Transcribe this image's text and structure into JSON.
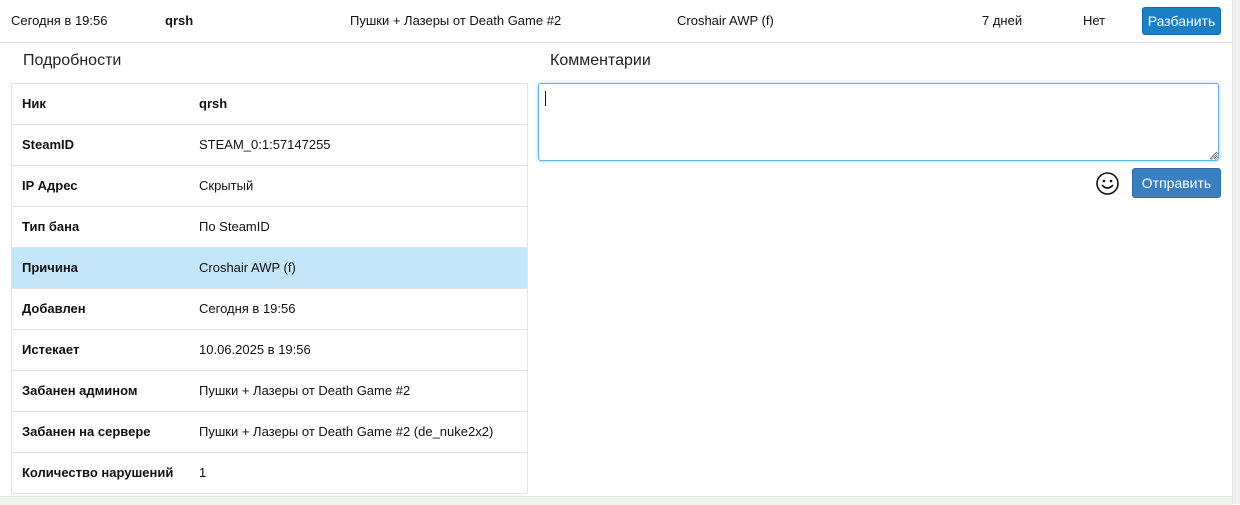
{
  "ban_row": {
    "date": "Сегодня в 19:56",
    "nick": "qrsh",
    "admin": "Пушки + Лазеры от Death Game #2",
    "reason": "Croshair AWP (f)",
    "duration": "7 дней",
    "status": "Нет",
    "unban_label": "Разбанить",
    "accent": "#1a7fc4"
  },
  "details": {
    "title": "Подробности",
    "rows": [
      {
        "label": "Ник",
        "value": "qrsh"
      },
      {
        "label": "SteamID",
        "value": "STEAM_0:1:57147255"
      },
      {
        "label": "IP Адрес",
        "value": "Скрытый"
      },
      {
        "label": "Тип бана",
        "value": "По SteamID"
      },
      {
        "label": "Причина",
        "value": "Croshair AWP (f)"
      },
      {
        "label": "Добавлен",
        "value": "Сегодня в 19:56"
      },
      {
        "label": "Истекает",
        "value": "10.06.2025 в 19:56"
      },
      {
        "label": "Забанен админом",
        "value": "Пушки + Лазеры от Death Game #2"
      },
      {
        "label": "Забанен на сервере",
        "value": "Пушки + Лазеры от Death Game #2 (de_nuke2x2)"
      },
      {
        "label": "Количество нарушений",
        "value": "1"
      }
    ],
    "highlight_color": "#c4e6f9"
  },
  "comments": {
    "title": "Комментарии",
    "input_value": "",
    "emoji_icon": "smiley-icon",
    "send_label": "Отправить"
  }
}
